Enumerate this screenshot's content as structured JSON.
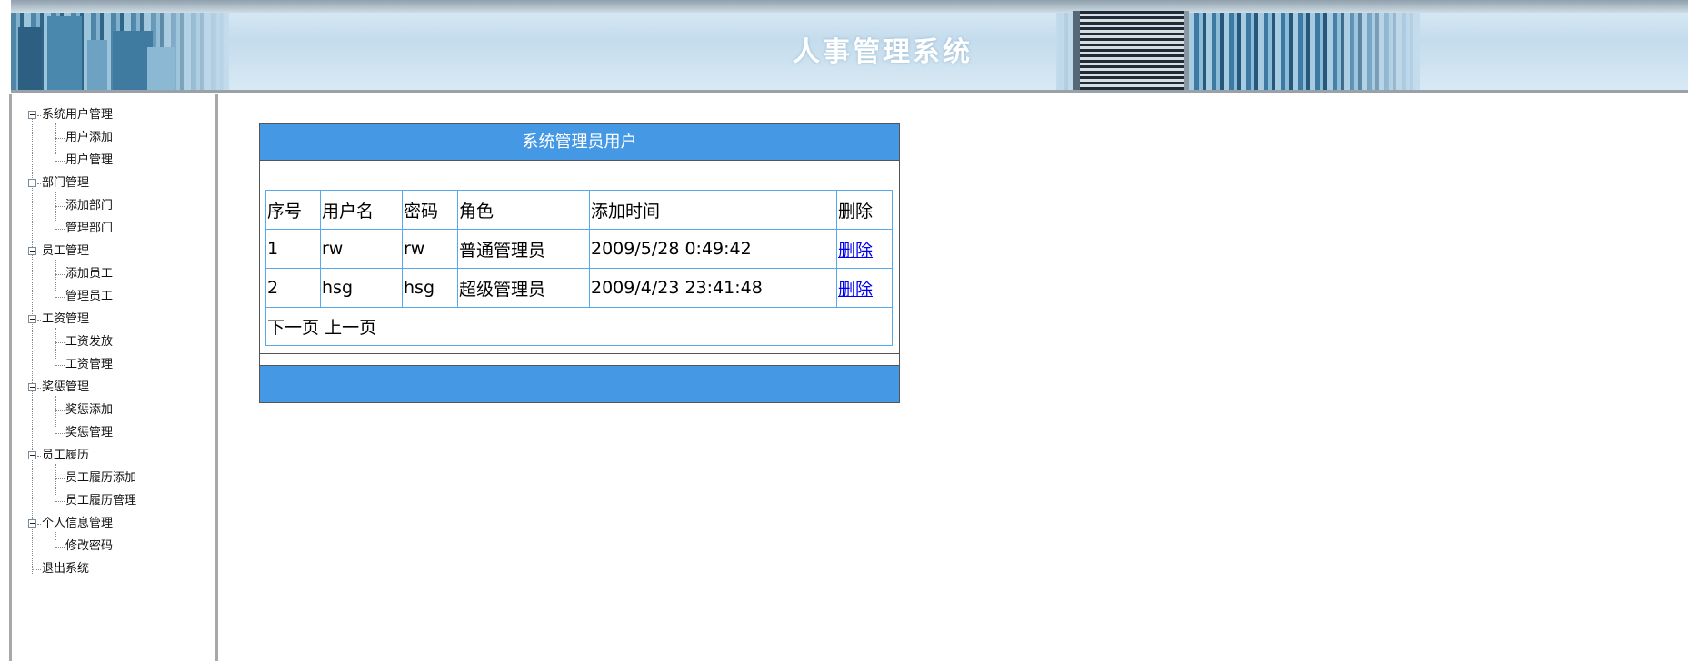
{
  "app": {
    "title": "人事管理系统"
  },
  "sidebar": {
    "groups": [
      {
        "label": "系统用户管理",
        "children": [
          "用户添加",
          "用户管理"
        ]
      },
      {
        "label": "部门管理",
        "children": [
          "添加部门",
          "管理部门"
        ]
      },
      {
        "label": "员工管理",
        "children": [
          "添加员工",
          "管理员工"
        ]
      },
      {
        "label": "工资管理",
        "children": [
          "工资发放",
          "工资管理"
        ]
      },
      {
        "label": "奖惩管理",
        "children": [
          "奖惩添加",
          "奖惩管理"
        ]
      },
      {
        "label": "员工履历",
        "children": [
          "员工履历添加",
          "员工履历管理"
        ]
      },
      {
        "label": "个人信息管理",
        "children": [
          "修改密码"
        ]
      }
    ],
    "exit_label": "退出系统"
  },
  "panel": {
    "title": "系统管理员用户",
    "columns": [
      "序号",
      "用户名",
      "密码",
      "角色",
      "添加时间",
      "删除"
    ],
    "rows": [
      {
        "id": "1",
        "username": "rw",
        "password": "rw",
        "role": "普通管理员",
        "added": "2009/5/28 0:49:42",
        "delete_label": "删除"
      },
      {
        "id": "2",
        "username": "hsg",
        "password": "hsg",
        "role": "超级管理员",
        "added": "2009/4/23 23:41:48",
        "delete_label": "删除"
      }
    ],
    "pager": {
      "next_label": "下一页",
      "prev_label": "上一页"
    }
  },
  "colors": {
    "header_bar": "#4598e4",
    "table_border": "#57a8ec",
    "link": "#0000ee"
  }
}
